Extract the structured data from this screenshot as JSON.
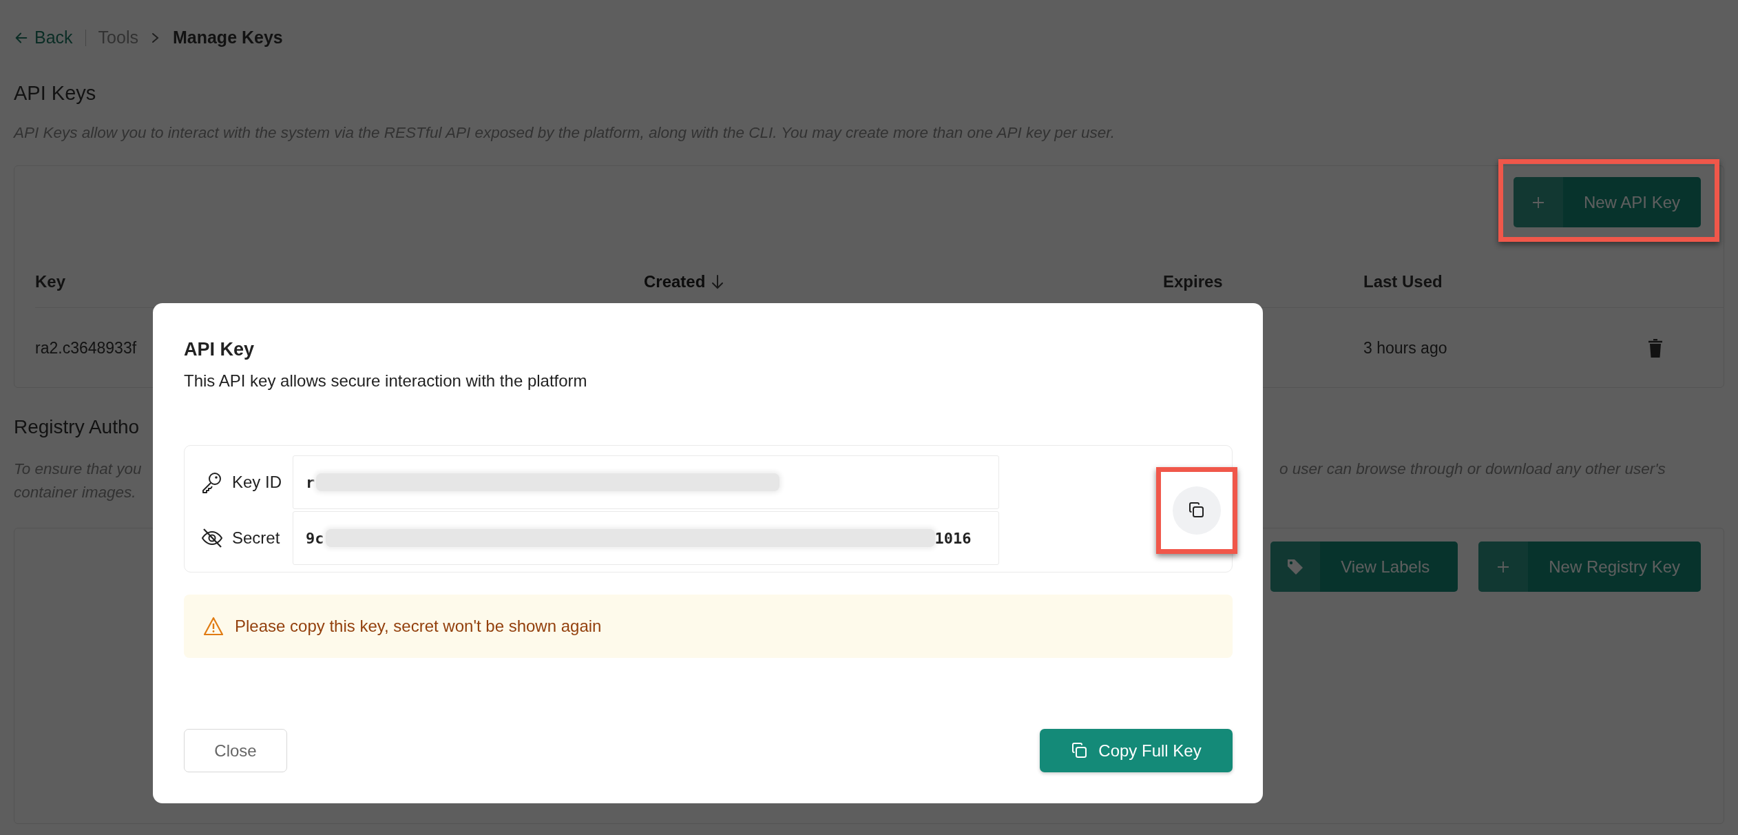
{
  "breadcrumb": {
    "back": "Back",
    "items": [
      {
        "label": "Tools",
        "current": false
      },
      {
        "label": "Manage Keys",
        "current": true
      }
    ]
  },
  "api_keys": {
    "title": "API Keys",
    "description": "API Keys allow you to interact with the system via the RESTful API exposed by the platform, along with the CLI. You may create more than one API key per user.",
    "new_button": {
      "label": "New API Key",
      "highlighted": true
    },
    "columns": [
      {
        "label": "Key",
        "sorted": false
      },
      {
        "label": "Created",
        "sorted": true
      },
      {
        "label": "Expires",
        "sorted": false
      },
      {
        "label": "Last Used",
        "sorted": false
      }
    ],
    "rows": [
      {
        "key": "ra2.c3648933f",
        "last_used": "3 hours ago"
      }
    ]
  },
  "registry": {
    "title": "Registry Autho",
    "description_start": "To ensure that you",
    "description_end": "o user can browse through or download any other user's",
    "description_line2": "container images.",
    "buttons": [
      {
        "kind": "labels",
        "label": "View Labels"
      },
      {
        "kind": "new",
        "label": "New Registry Key"
      }
    ]
  },
  "modal": {
    "title": "API Key",
    "subtitle": "This API key allows secure interaction with the platform",
    "fields": [
      {
        "kind": "key",
        "label": "Key ID",
        "shown_start": "r",
        "redacted": true
      },
      {
        "kind": "secret",
        "label": "Secret",
        "shown_start": "9c",
        "shown_end": "1016",
        "redacted": true
      }
    ],
    "copy_button": {
      "highlighted": true
    },
    "warning": "Please copy this key, secret won't be shown again",
    "close": "Close",
    "copy_full": "Copy Full Key"
  }
}
